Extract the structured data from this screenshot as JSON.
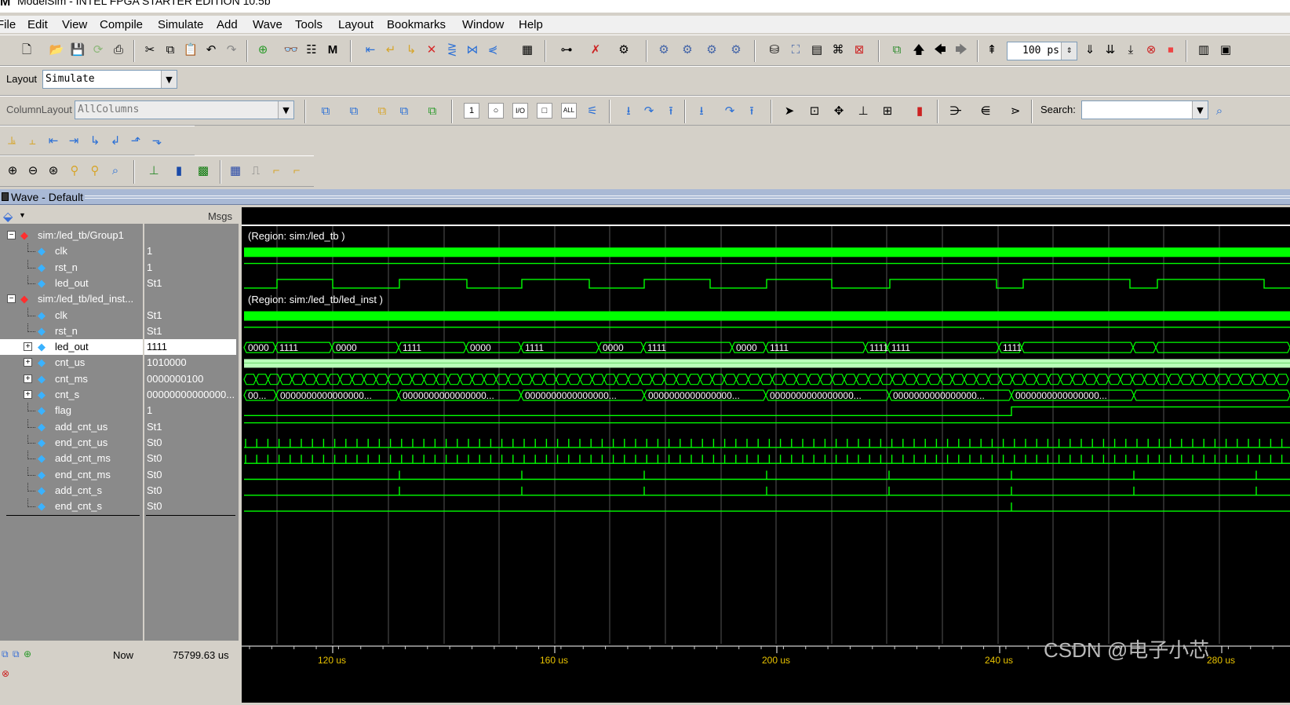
{
  "window": {
    "title": "ModelSim - INTEL FPGA STARTER EDITION 10.5b",
    "logo": "M"
  },
  "menu": [
    "File",
    "Edit",
    "View",
    "Compile",
    "Simulate",
    "Add",
    "Wave",
    "Tools",
    "Layout",
    "Bookmarks",
    "Window",
    "Help"
  ],
  "toolbar": {
    "layout_label": "Layout",
    "layout_value": "Simulate",
    "columnlayout_label": "ColumnLayout",
    "columnlayout_value": "AllColumns",
    "run_length": "100 ps",
    "search_label": "Search:",
    "search_value": ""
  },
  "wave_window": {
    "title": "Wave - Default",
    "msgs_header": "Msgs",
    "now_label": "Now",
    "now_value": "75799.63 us"
  },
  "signals": [
    {
      "name": "sim:/led_tb/Group1",
      "value": "",
      "kind": "group",
      "region": "(Region: sim:/led_tb )"
    },
    {
      "name": "clk",
      "value": "1",
      "kind": "bit"
    },
    {
      "name": "rst_n",
      "value": "1",
      "kind": "bit"
    },
    {
      "name": "led_out",
      "value": "St1",
      "kind": "bit"
    },
    {
      "name": "sim:/led_tb/led_inst...",
      "value": "",
      "kind": "group",
      "region": "(Region: sim:/led_tb/led_inst )"
    },
    {
      "name": "clk",
      "value": "St1",
      "kind": "bit"
    },
    {
      "name": "rst_n",
      "value": "St1",
      "kind": "bit"
    },
    {
      "name": "led_out",
      "value": "1111",
      "kind": "bus",
      "selected": true
    },
    {
      "name": "cnt_us",
      "value": "1010000",
      "kind": "bus"
    },
    {
      "name": "cnt_ms",
      "value": "0000000100",
      "kind": "bus"
    },
    {
      "name": "cnt_s",
      "value": "00000000000000...",
      "kind": "bus"
    },
    {
      "name": "flag",
      "value": "1",
      "kind": "bit"
    },
    {
      "name": "add_cnt_us",
      "value": "St1",
      "kind": "bit"
    },
    {
      "name": "end_cnt_us",
      "value": "St0",
      "kind": "bit"
    },
    {
      "name": "add_cnt_ms",
      "value": "St0",
      "kind": "bit"
    },
    {
      "name": "end_cnt_ms",
      "value": "St0",
      "kind": "bit"
    },
    {
      "name": "add_cnt_s",
      "value": "St0",
      "kind": "bit"
    },
    {
      "name": "end_cnt_s",
      "value": "St0",
      "kind": "bit"
    }
  ],
  "led_bus_labels": [
    "0000",
    "1111",
    "0000",
    "1111",
    "0000",
    "1111",
    "0000",
    "1111",
    "0000",
    "1111",
    "1111",
    "1111",
    "1111"
  ],
  "cnt_s_labels": [
    "00...",
    "0000000000000000...",
    "0000000000000000...",
    "0000000000000000...",
    "0000000000000000...",
    "0000000000000000...",
    "0000000000000000...",
    "0000000000000000..."
  ],
  "time_axis": {
    "labels": [
      "120 us",
      "160 us",
      "200 us",
      "240 us",
      "280 us"
    ]
  },
  "colors": {
    "wave": "#00ff00",
    "bus": "#00ff00",
    "selected": "#ffffff",
    "background": "#000000",
    "cnt_us_bus": "#b9ffb9"
  },
  "watermark": "CSDN @电子小芯"
}
